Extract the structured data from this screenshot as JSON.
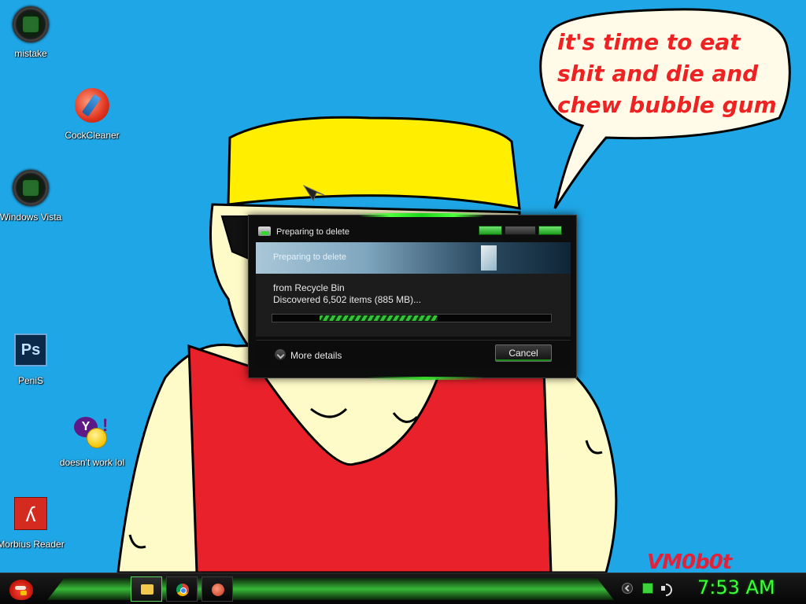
{
  "desktop": {
    "speech_bubble": "it's time to eat shit and die and chew bubble gum",
    "signature": "VM0b0t",
    "icons": [
      {
        "label": "mistake",
        "icon": "green-orb-icon"
      },
      {
        "label": "CockCleaner",
        "icon": "ccleaner-icon"
      },
      {
        "label": "Windows Vista",
        "icon": "green-orb-icon"
      },
      {
        "label": "PeniS",
        "icon": "photoshop-icon"
      },
      {
        "label": "doesn't work lol",
        "icon": "yahoo-messenger-icon"
      },
      {
        "label": "Morbius Reader",
        "icon": "acrobat-reader-icon"
      }
    ]
  },
  "dialog": {
    "title": "Preparing to delete",
    "banner": "Preparing to delete",
    "source": "from Recycle Bin",
    "status": "Discovered 6,502 items (885 MB)...",
    "progress": "indeterminate",
    "more_details": "More details",
    "cancel_label": "Cancel"
  },
  "taskbar": {
    "start_icon": "angry-bird-icon",
    "pinned": [
      "folder-icon",
      "chrome-icon",
      "ccleaner-icon"
    ],
    "tray": [
      "tray-expand-icon",
      "network-icon",
      "volume-icon"
    ],
    "clock": "7:53 AM"
  },
  "colors": {
    "background": "#1fa6e6",
    "accent_green": "#3dff3a",
    "bubble_text": "#ee2222"
  }
}
